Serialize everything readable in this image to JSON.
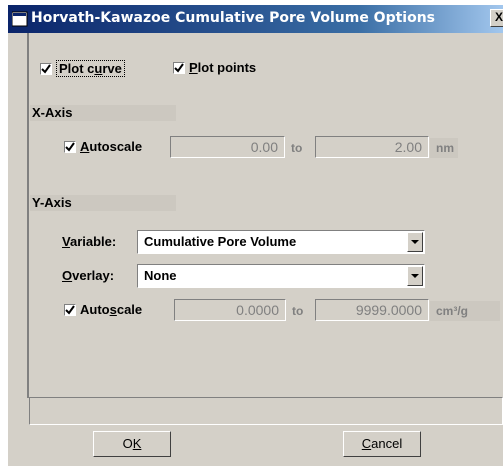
{
  "window": {
    "title": "Horvath-Kawazoe Cumulative Pore Volume Options",
    "close_label": "X"
  },
  "options": {
    "plot_curve": {
      "prefix": "Plot c",
      "accel": "u",
      "suffix": "rve",
      "checked": true
    },
    "plot_points": {
      "prefix": "",
      "accel": "P",
      "suffix": "lot points",
      "checked": true
    }
  },
  "x_axis": {
    "heading": "X-Axis",
    "autoscale": {
      "prefix": "",
      "accel": "A",
      "suffix": "utoscale",
      "checked": true
    },
    "from_value": "0.00",
    "to_label": "to",
    "to_value": "2.00",
    "unit": "nm"
  },
  "y_axis": {
    "heading": "Y-Axis",
    "variable": {
      "accel": "V",
      "suffix": "ariable:",
      "value": "Cumulative Pore Volume"
    },
    "overlay": {
      "accel": "O",
      "suffix": "verlay:",
      "value": "None"
    },
    "autoscale": {
      "prefix": "Auto",
      "accel": "s",
      "suffix": "cale",
      "checked": true
    },
    "from_value": "0.0000",
    "to_label": "to",
    "to_value": "9999.0000",
    "unit": "cm³/g"
  },
  "buttons": {
    "ok": {
      "prefix": "O",
      "accel": "K",
      "suffix": ""
    },
    "cancel": {
      "prefix": "",
      "accel": "C",
      "suffix": "ancel"
    }
  },
  "colors": {
    "title_bar": "#0a246a",
    "dialog_bg": "#d4d0c8",
    "section_bar": "#ccc8c0"
  }
}
